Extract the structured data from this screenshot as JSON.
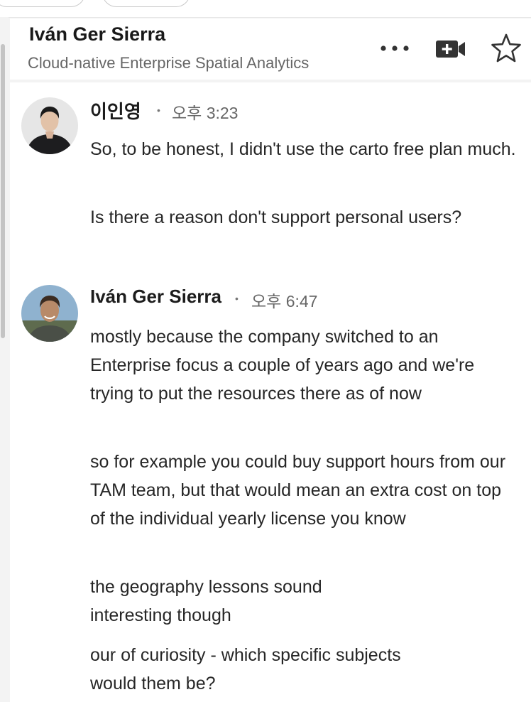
{
  "header": {
    "name": "Iván Ger Sierra",
    "subtitle": "Cloud-native Enterprise Spatial Analytics",
    "icons": {
      "more": "more-horizontal-icon",
      "video": "video-call-icon",
      "star": "star-icon"
    }
  },
  "messages": [
    {
      "sender": "이인영",
      "separator": "•",
      "time": "오후 3:23",
      "paragraphs": [
        "So, to be honest, I didn't use the carto free plan much.",
        "Is there a reason don't support personal users?"
      ]
    },
    {
      "sender": "Iván Ger Sierra",
      "separator": "•",
      "time": "오후 6:47",
      "paragraphs": [
        "mostly because the company switched to an Enterprise focus a couple of years ago and we're trying to put the resources there as of now",
        "so for example you could buy support hours from our TAM team, but that would mean an extra cost on top of the individual yearly license you know",
        "the geography lessons sound interesting though",
        "our of curiosity - which specific subjects would them be?"
      ]
    }
  ],
  "colors": {
    "background": "#f3f3f3",
    "panel": "#ffffff",
    "text": "#262626",
    "muted": "#666666",
    "icon": "#333333"
  }
}
